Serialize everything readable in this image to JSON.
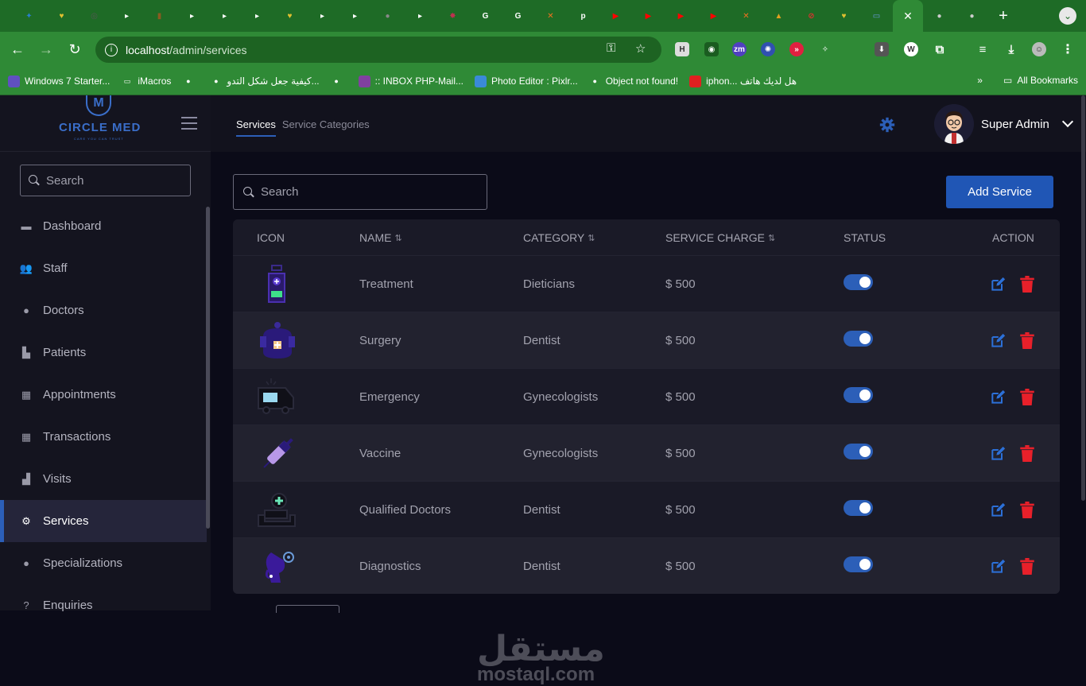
{
  "browser": {
    "url_host": "localhost",
    "url_path": "/admin/services",
    "tabs": [
      {
        "icon": "app-icon",
        "color": "#2a7fd0",
        "glyph": "✦"
      },
      {
        "icon": "heart-icon",
        "color": "#e0c030",
        "glyph": "♥"
      },
      {
        "icon": "spiral-icon",
        "color": "#555",
        "glyph": "◎"
      },
      {
        "icon": "doc-icon",
        "color": "#fff",
        "glyph": "▸"
      },
      {
        "icon": "book-icon",
        "color": "#8a5a20",
        "glyph": "▮"
      },
      {
        "icon": "doc-icon",
        "color": "#fff",
        "glyph": "▸"
      },
      {
        "icon": "doc-icon",
        "color": "#fff",
        "glyph": "▸"
      },
      {
        "icon": "doc-icon",
        "color": "#fff",
        "glyph": "▸"
      },
      {
        "icon": "heart-icon",
        "color": "#e0c030",
        "glyph": "♥"
      },
      {
        "icon": "doc-icon",
        "color": "#fff",
        "glyph": "▸"
      },
      {
        "icon": "doc-icon",
        "color": "#fff",
        "glyph": "▸"
      },
      {
        "icon": "globe-icon",
        "color": "#888",
        "glyph": "●"
      },
      {
        "icon": "doc-icon",
        "color": "#fff",
        "glyph": "▸"
      },
      {
        "icon": "figure-icon",
        "color": "#c03050",
        "glyph": "✸"
      },
      {
        "icon": "google-icon",
        "color": "#fff",
        "glyph": "G"
      },
      {
        "icon": "google-icon",
        "color": "#fff",
        "glyph": "G"
      },
      {
        "icon": "xampp-icon",
        "color": "#f07020",
        "glyph": "✕"
      },
      {
        "icon": "php-icon",
        "color": "#fff",
        "glyph": "p"
      },
      {
        "icon": "youtube-icon",
        "color": "#f00",
        "glyph": "▶"
      },
      {
        "icon": "youtube-icon",
        "color": "#f00",
        "glyph": "▶"
      },
      {
        "icon": "youtube-icon",
        "color": "#f00",
        "glyph": "▶"
      },
      {
        "icon": "youtube-icon",
        "color": "#f00",
        "glyph": "▶"
      },
      {
        "icon": "xampp-icon",
        "color": "#f07020",
        "glyph": "✕"
      },
      {
        "icon": "warning-icon",
        "color": "#e0a020",
        "glyph": "▲"
      },
      {
        "icon": "block-icon",
        "color": "#e03030",
        "glyph": "⊘"
      },
      {
        "icon": "heart-icon",
        "color": "#e0c030",
        "glyph": "♥"
      },
      {
        "icon": "screen-icon",
        "color": "#6a9ae0",
        "glyph": "▭"
      }
    ],
    "bookmarks": [
      {
        "label": "Windows 7 Starter...",
        "icon": "windows-icon",
        "color": "#6050c0"
      },
      {
        "label": "iMacros",
        "icon": "folder-icon",
        "color": "transparent"
      },
      {
        "label": "",
        "icon": "globe-icon",
        "color": "transparent"
      },
      {
        "label": "كيفية جعل شكل التدو...",
        "icon": "globe-icon",
        "color": "transparent"
      },
      {
        "label": "",
        "icon": "globe-icon",
        "color": "transparent"
      },
      {
        "label": ":: INBOX PHP-Mail...",
        "icon": "mail-icon",
        "color": "#8040a0"
      },
      {
        "label": "Photo Editor : Pixlr...",
        "icon": "pixlr-icon",
        "color": "#3a8ad8"
      },
      {
        "label": "Object not found!",
        "icon": "globe-icon",
        "color": "transparent"
      },
      {
        "label": "iphon... هل لديك هاتف",
        "icon": "youtube-icon",
        "color": "#e02020"
      }
    ],
    "all_bookmarks": "All Bookmarks"
  },
  "brand": {
    "name": "CIRCLE MED",
    "tagline": "CARE YOU CAN TRUST",
    "initial": "M",
    "color": "#3a6ec9"
  },
  "sidebar": {
    "search_placeholder": "Search",
    "items": [
      {
        "label": "Dashboard",
        "icon": "dashboard-icon",
        "glyph": "▬",
        "active": false
      },
      {
        "label": "Staff",
        "icon": "staff-icon",
        "glyph": "👥",
        "active": false
      },
      {
        "label": "Doctors",
        "icon": "doctor-icon",
        "glyph": "●",
        "active": false
      },
      {
        "label": "Patients",
        "icon": "patients-icon",
        "glyph": "▙",
        "active": false
      },
      {
        "label": "Appointments",
        "icon": "calendar-icon",
        "glyph": "▦",
        "active": false
      },
      {
        "label": "Transactions",
        "icon": "transactions-icon",
        "glyph": "▦",
        "active": false
      },
      {
        "label": "Visits",
        "icon": "bed-icon",
        "glyph": "▟",
        "active": false
      },
      {
        "label": "Services",
        "icon": "services-icon",
        "glyph": "⚙",
        "active": true
      },
      {
        "label": "Specializations",
        "icon": "specialization-icon",
        "glyph": "●",
        "active": false
      },
      {
        "label": "Enquiries",
        "icon": "help-icon",
        "glyph": "?",
        "active": false
      }
    ]
  },
  "topbar": {
    "tabs": [
      {
        "label": "Services",
        "active": true
      },
      {
        "label": "Service Categories",
        "active": false
      }
    ],
    "user_name": "Super Admin"
  },
  "main": {
    "search_placeholder": "Search",
    "add_button": "Add Service",
    "columns": {
      "icon": "ICON",
      "name": "NAME",
      "category": "CATEGORY",
      "charge": "SERVICE CHARGE",
      "status": "STATUS",
      "action": "ACTION"
    },
    "rows": [
      {
        "name": "Treatment",
        "category": "Dieticians",
        "charge": "$ 500",
        "status": true,
        "icon": "medicine-bottle-icon"
      },
      {
        "name": "Surgery",
        "category": "Dentist",
        "charge": "$ 500",
        "status": true,
        "icon": "surgery-icon"
      },
      {
        "name": "Emergency",
        "category": "Gynecologists",
        "charge": "$ 500",
        "status": true,
        "icon": "ambulance-icon"
      },
      {
        "name": "Vaccine",
        "category": "Gynecologists",
        "charge": "$ 500",
        "status": true,
        "icon": "vaccine-icon"
      },
      {
        "name": "Qualified Doctors",
        "category": "Dentist",
        "charge": "$ 500",
        "status": true,
        "icon": "qualified-doctor-icon"
      },
      {
        "name": "Diagnostics",
        "category": "Dentist",
        "charge": "$ 500",
        "status": true,
        "icon": "diagnostics-icon"
      }
    ]
  },
  "watermark": {
    "arabic": "مستقل",
    "latin": "mostaql.com"
  },
  "colors": {
    "accent": "#2c5fb8",
    "delete": "#e8202a",
    "sidebar_bg": "#14141f",
    "row_alt": "#22222f"
  }
}
